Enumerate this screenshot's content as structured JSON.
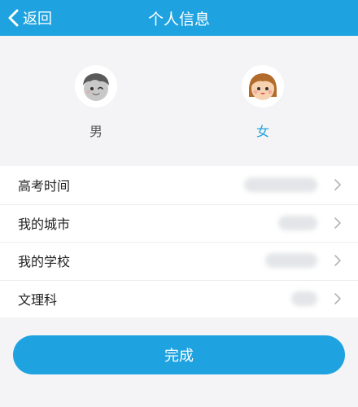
{
  "header": {
    "back_label": "返回",
    "title": "个人信息"
  },
  "gender": {
    "options": [
      {
        "label": "男",
        "selected": false
      },
      {
        "label": "女",
        "selected": true
      }
    ],
    "selected_color": "#1fa3e0"
  },
  "info_rows": [
    {
      "label": "高考时间"
    },
    {
      "label": "我的城市"
    },
    {
      "label": "我的学校"
    },
    {
      "label": "文理科"
    }
  ],
  "submit_label": "完成",
  "accent_color": "#1fa3e0"
}
